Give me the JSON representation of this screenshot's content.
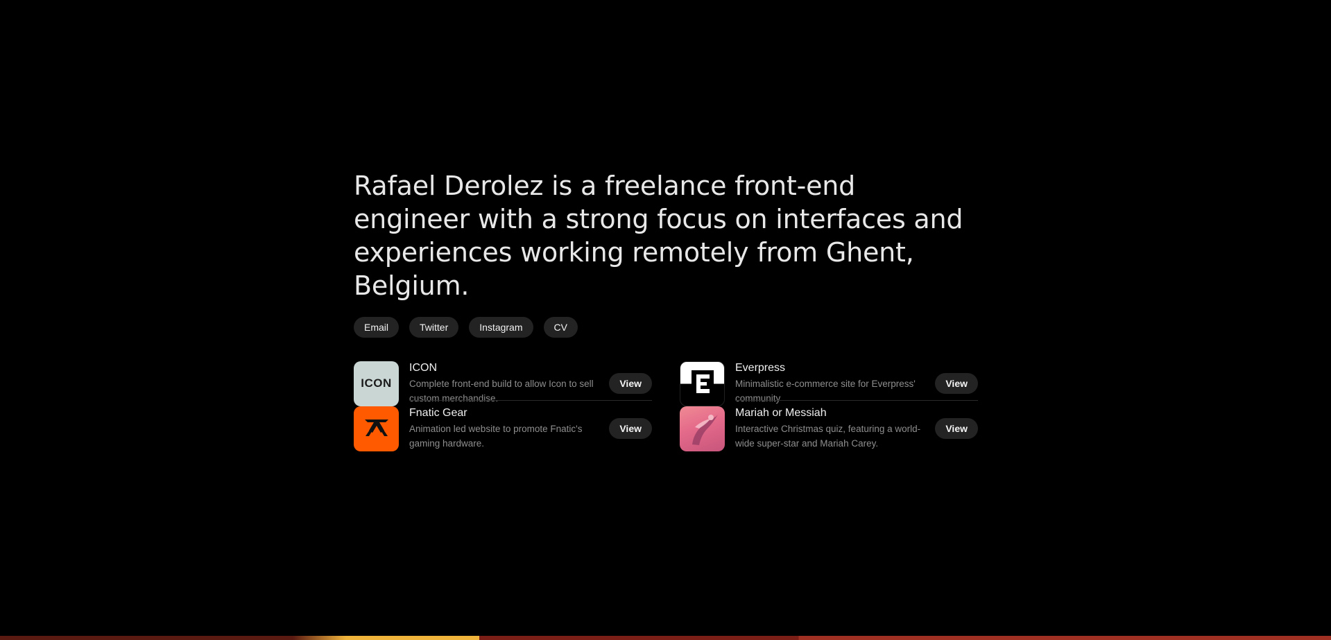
{
  "intro": {
    "headline": "Rafael Derolez is a freelance front-end engineer with a strong focus on interfaces and experiences working remotely from Ghent, Belgium."
  },
  "links": [
    {
      "label": "Email"
    },
    {
      "label": "Twitter"
    },
    {
      "label": "Instagram"
    },
    {
      "label": "CV"
    }
  ],
  "projects": [
    {
      "title": "ICON",
      "description": "Complete front-end build to allow Icon to sell custom merchandise.",
      "thumb_text": "ICON",
      "thumb_color": "#c9d6d4",
      "view_label": "View"
    },
    {
      "title": "Everpress",
      "description": "Minimalistic e-commerce site for Everpress' community",
      "thumb_text": "E",
      "view_label": "View"
    },
    {
      "title": "Fnatic Gear",
      "description": "Animation led website to promote Fnatic's gaming hardware.",
      "thumb_color": "#ff5a00",
      "view_label": "View"
    },
    {
      "title": "Mariah or Messiah",
      "description": "Interactive Christmas quiz, featuring a world-wide super-star and Mariah Carey.",
      "thumb_color": "#e46a8a",
      "view_label": "View"
    }
  ]
}
